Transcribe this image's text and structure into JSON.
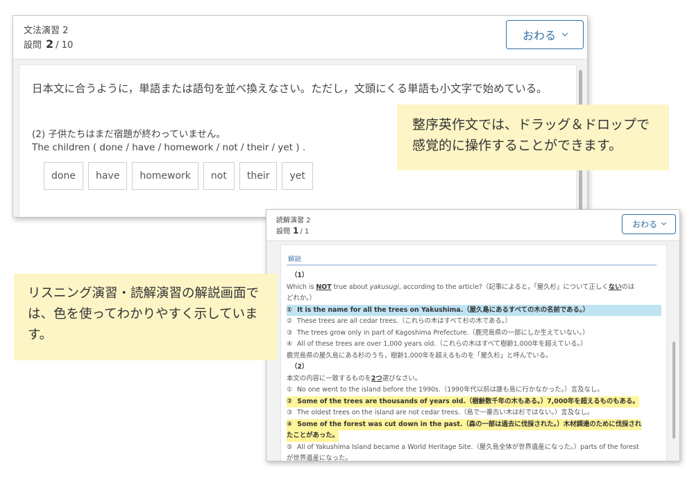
{
  "win1": {
    "title": "文法演習 2",
    "question_label": "設問",
    "question_current": "2",
    "question_total": "/ 10",
    "end_button": "おわる",
    "instruction": "日本文に合うように，単語または語句を並べ換えなさい。ただし，文頭にくる単語も小文字で始めている。",
    "question_jp": "(2)  子供たちはまだ宿題が終わっていません。",
    "question_en": "The children ( done / have / homework / not / their / yet ) .",
    "tiles": [
      "done",
      "have",
      "homework",
      "not",
      "their",
      "yet"
    ]
  },
  "notes": {
    "drag_note": "整序英作文では、ドラッグ＆ドロップで感覚的に操作することができます。",
    "color_note": "リスニング演習・読解演習の解説画面では、色を使ってわかりやすく示しています。"
  },
  "win2": {
    "title": "読解演習 2",
    "question_label": "設問",
    "question_current": "1",
    "question_total": "/ 1",
    "end_button": "おわる",
    "section_heading": "解説",
    "q1": {
      "label": "（1）",
      "prompt_a": "Which is ",
      "prompt_not": "NOT",
      "prompt_b": " true about ",
      "prompt_yakusugi": "yakusugi",
      "prompt_c": ", according to the article?（記事によると，「屋久杉」について正しく",
      "prompt_nai": "ない",
      "prompt_d": "のは",
      "prompt_line2": "どれか。）",
      "choices": [
        {
          "mark": "①",
          "text": "It is the name for all the trees on Yakushima.（屋久島にあるすべての木の名前である。）"
        },
        {
          "mark": "②",
          "text": "These trees are all cedar trees.（これらの木はすべて杉の木である。）"
        },
        {
          "mark": "③",
          "text": "The trees grow only in part of Kagoshima Prefecture.（鹿児島県の一部にしか生えていない。）"
        },
        {
          "mark": "④",
          "text": "All of these trees are over 1,000 years old.（これらの木はすべて樹齢1,000年を超えている。）"
        }
      ],
      "explanation": "鹿児島県の屋久島にある杉のうち，樹齢1,000年を超えるものを「屋久杉」と呼んでいる。"
    },
    "q2": {
      "label": "（2）",
      "prompt_a": "本文の内容に一致するものを",
      "prompt_two": "2つ",
      "prompt_b": "選びなさい。",
      "choices": [
        {
          "mark": "①",
          "text": "No one went to the island before the 1990s.（1990年代以前は誰も島に行かなかった。）言及なし。"
        },
        {
          "mark": "②",
          "text": "Some of the trees are thousands of years old.（樹齢数千年の木もある。）7,000年を超えるものもある。"
        },
        {
          "mark": "③",
          "text": "The oldest trees on the island are not cedar trees.（島で一番古い木は杉ではない。）言及なし。"
        },
        {
          "mark": "④",
          "text": "Some of the forest was cut down in the past.（森の一部は過去に伐採された。）木材調達のために伐採され"
        },
        {
          "mark": "",
          "text": "たことがあった。"
        },
        {
          "mark": "⑤",
          "text": "All of Yakushima Island became a World Heritage Site.（屋久島全体が世界遺産になった。）parts of the forest"
        },
        {
          "mark": "",
          "text": "が世界遺産になった。"
        }
      ]
    }
  },
  "colors": {
    "accent": "#2f6fa6",
    "highlight_correct_blue": "#bfe3f3",
    "highlight_correct_yellow": "#fff59a",
    "note_background": "#fdf5c6"
  }
}
